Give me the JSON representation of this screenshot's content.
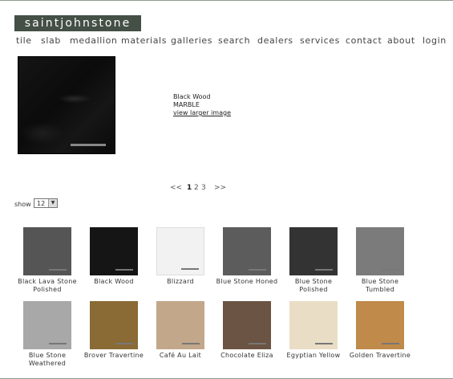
{
  "logo": "saintjohnstone",
  "nav": [
    "tile",
    "slab",
    "medallion",
    "materials",
    "galleries",
    "search",
    "dealers",
    "services",
    "contact",
    "about",
    "login"
  ],
  "featured": {
    "name": "Black Wood",
    "type": "MARBLE",
    "link": "view larger image"
  },
  "pager": {
    "prev": "<<",
    "current": "1",
    "pages": [
      "2",
      "3"
    ],
    "next": ">>"
  },
  "show": {
    "label": "show",
    "value": "12"
  },
  "tiles": [
    {
      "name": "Black Lava Stone Polished",
      "color": "#555555"
    },
    {
      "name": "Black Wood",
      "color": "#151515"
    },
    {
      "name": "Blizzard",
      "color": "#f2f2f2"
    },
    {
      "name": "Blue Stone Honed",
      "color": "#5c5c5c"
    },
    {
      "name": "Blue Stone Polished",
      "color": "#333333"
    },
    {
      "name": "Blue Stone Tumbled",
      "color": "#7b7b7b"
    },
    {
      "name": "Blue Stone Weathered",
      "color": "#a8a8a8"
    },
    {
      "name": "Brover Travertine",
      "color": "#8a6a35"
    },
    {
      "name": "Café Au Lait",
      "color": "#c2a78a"
    },
    {
      "name": "Chocolate Eliza",
      "color": "#6b5443"
    },
    {
      "name": "Egyptian Yellow",
      "color": "#eaddc6"
    },
    {
      "name": "Golden Travertine",
      "color": "#c08a4a"
    }
  ]
}
